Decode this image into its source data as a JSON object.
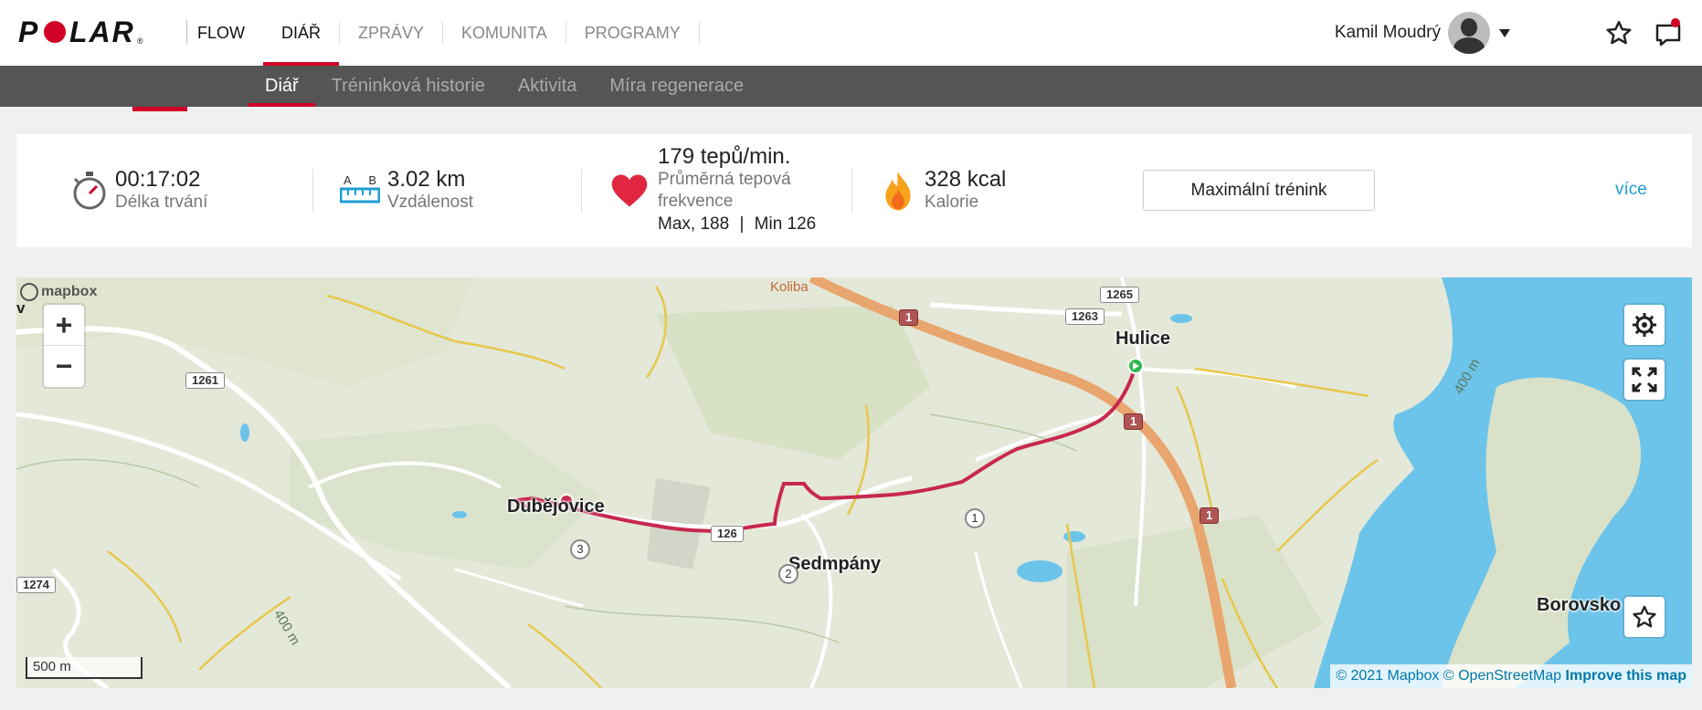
{
  "header": {
    "logo": "POLAR",
    "nav": [
      {
        "label": "FLOW"
      },
      {
        "label": "DIÁŘ"
      },
      {
        "label": "ZPRÁVY"
      },
      {
        "label": "KOMUNITA"
      },
      {
        "label": "PROGRAMY"
      }
    ],
    "user_name": "Kamil Moudrý"
  },
  "subnav": {
    "tabs": [
      {
        "label": "Diář"
      },
      {
        "label": "Tréninková historie"
      },
      {
        "label": "Aktivita"
      },
      {
        "label": "Míra regenerace"
      }
    ]
  },
  "summary": {
    "duration": {
      "value": "00:17:02",
      "label": "Délka trvání"
    },
    "distance": {
      "a": "A",
      "b": "B",
      "value": "3.02 km",
      "label": "Vzdálenost"
    },
    "heart_rate": {
      "value": "179 tepů/min.",
      "label": "Průměrná tepová frekvence",
      "max": "Max, 188",
      "separator": "|",
      "min": "Min 126"
    },
    "calories": {
      "value": "328 kcal",
      "label": "Kalorie"
    },
    "training_button": "Maximální trénink",
    "more_link": "více"
  },
  "map": {
    "provider_logo": "mapbox",
    "places": {
      "hulice": "Hulice",
      "dubejovice": "Dubějovice",
      "sedmpany": "Sedmpány",
      "borovsko": "Borovsko",
      "koliba": "Koliba",
      "edge_v": "v"
    },
    "road_numbers": {
      "r1261": "1261",
      "r1263": "1263",
      "r1265": "1265",
      "r1274": "1274",
      "r1_a": "1",
      "r1_b": "1",
      "r1_c": "1",
      "r126": "126"
    },
    "contour_labels": {
      "c1": "400 m",
      "c2": "400 m"
    },
    "route_markers": {
      "m1": "1",
      "m2": "2",
      "m3": "3"
    },
    "scale": "500 m",
    "attribution": {
      "mapbox": "© 2021 Mapbox",
      "osm": "© OpenStreetMap",
      "improve": "Improve this map"
    },
    "zoom_in": "+",
    "zoom_out": "−"
  },
  "colors": {
    "brand_red": "#d10027",
    "link_blue": "#1e9fd8",
    "route": "#c8284f",
    "water": "#6cc4ea"
  }
}
